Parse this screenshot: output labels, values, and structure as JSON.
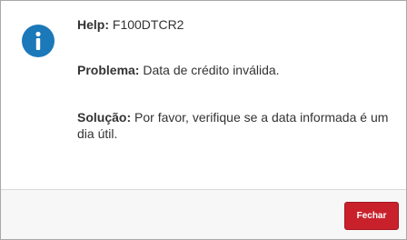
{
  "dialog": {
    "icon": "info-icon",
    "help": {
      "label": "Help:",
      "value": "F100DTCR2"
    },
    "problema": {
      "label": "Problema:",
      "value": "Data de crédito inválida."
    },
    "solucao": {
      "label": "Solução:",
      "value": "Por favor, verifique se a data informada é um dia útil."
    }
  },
  "footer": {
    "close_label": "Fechar"
  },
  "colors": {
    "icon": "#1b78b9",
    "button": "#c9212b",
    "footer_bg": "#f7f7f7"
  }
}
